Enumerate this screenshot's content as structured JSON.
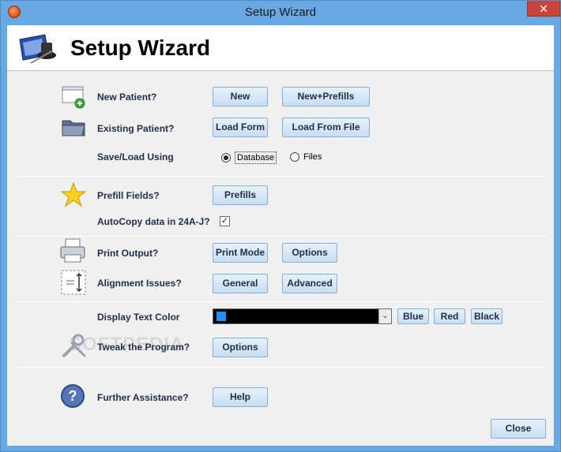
{
  "window": {
    "title": "Setup Wizard",
    "close_glyph": "✕"
  },
  "header": {
    "title": "Setup Wizard",
    "icon": "wizard-hat-icon"
  },
  "rows": {
    "new_patient": {
      "label": "New Patient?",
      "icon": "new-document-icon",
      "buttons": [
        "New",
        "New+Prefills"
      ]
    },
    "existing_patient": {
      "label": "Existing Patient?",
      "icon": "folder-icon",
      "buttons": [
        "Load Form",
        "Load From File"
      ]
    },
    "save_load": {
      "label": "Save/Load Using",
      "options": [
        "Database",
        "Files"
      ],
      "selected": "Database"
    },
    "prefill": {
      "label": "Prefill Fields?",
      "icon": "star-icon",
      "button": "Prefills"
    },
    "autocopy": {
      "label": "AutoCopy data in 24A-J?",
      "checked": true,
      "check_glyph": "✓"
    },
    "print_output": {
      "label": "Print Output?",
      "icon": "printer-icon",
      "buttons": [
        "Print Mode",
        "Options"
      ]
    },
    "alignment": {
      "label": "Alignment Issues?",
      "icon": "alignment-icon",
      "buttons": [
        "General",
        "Advanced"
      ]
    },
    "display_color": {
      "label": "Display Text Color",
      "selected_color": "#1e90ff",
      "buttons": [
        "Blue",
        "Red",
        "Black"
      ],
      "arrow": "⌄"
    },
    "tweak": {
      "label": "Tweak the Program?",
      "icon": "tools-icon",
      "button": "Options"
    },
    "assistance": {
      "label": "Further Assistance?",
      "icon": "help-icon",
      "button": "Help"
    }
  },
  "footer": {
    "close_label": "Close"
  },
  "watermark": "SOFTPEDIA",
  "colors": {
    "frame": "#6aa8e3",
    "button_text": "#1f2e4a"
  }
}
